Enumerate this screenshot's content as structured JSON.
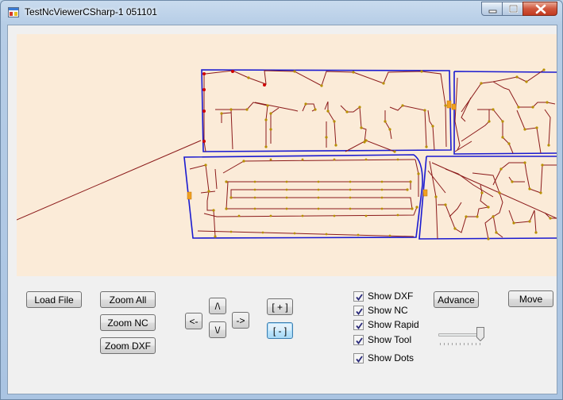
{
  "window": {
    "title": "TestNcViewerCSharp-1 051101"
  },
  "toolbar": {
    "load_file": "Load File",
    "zoom_all": "Zoom All",
    "zoom_nc": "Zoom NC",
    "zoom_dxf": "Zoom DXF",
    "pan_left": "<-",
    "pan_up": "/\\",
    "pan_down": "\\/",
    "pan_right": "->",
    "zoom_in": "[ + ]",
    "zoom_out": "[ - ]",
    "advance": "Advance",
    "move": "Move"
  },
  "options": {
    "show_dxf": {
      "label": "Show DXF",
      "checked": true
    },
    "show_nc": {
      "label": "Show NC",
      "checked": true
    },
    "show_rapid": {
      "label": "Show Rapid",
      "checked": true
    },
    "show_tool": {
      "label": "Show Tool",
      "checked": true
    },
    "show_dots": {
      "label": "Show Dots",
      "checked": true
    }
  },
  "speed_slider": {
    "value_fraction": 0.85
  },
  "colors": {
    "canvas_bg": "#fbebd8",
    "dxf_outline": "#1a1ad0",
    "nc_path": "#8b1a1a",
    "dots": "#c8a000",
    "tool_marker": "#f0a020"
  },
  "icons": {
    "app": "app-window-icon",
    "minimize": "minimize-icon",
    "maximize": "maximize-icon",
    "close": "close-icon"
  }
}
